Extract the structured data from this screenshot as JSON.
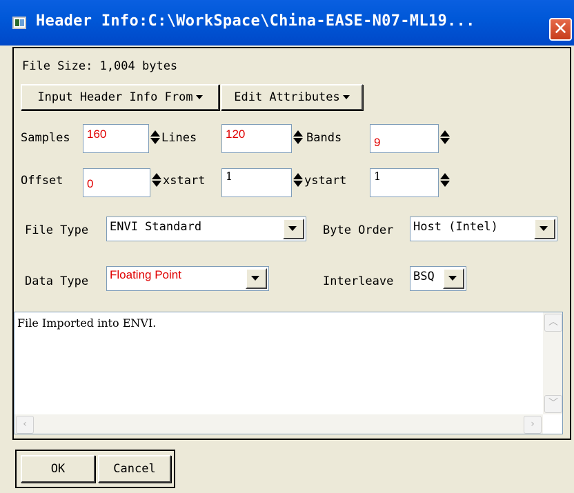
{
  "window": {
    "title": "Header Info:C:\\WorkSpace\\China-EASE-N07-ML19...",
    "close_glyph": "✕"
  },
  "file_size": "File Size: 1,004 bytes",
  "toolbar": {
    "input_header_label": "Input Header Info From",
    "edit_attributes_label": "Edit Attributes"
  },
  "fields": {
    "samples": {
      "label": "Samples",
      "value": "160"
    },
    "lines": {
      "label": "Lines",
      "value": "120"
    },
    "bands": {
      "label": "Bands",
      "value": "9"
    },
    "offset": {
      "label": "Offset",
      "value": "0"
    },
    "xstart": {
      "label": "xstart",
      "value": "1"
    },
    "ystart": {
      "label": "ystart",
      "value": "1"
    }
  },
  "selects": {
    "file_type": {
      "label": "File Type",
      "value": "ENVI Standard"
    },
    "byte_order": {
      "label": "Byte Order",
      "value": "Host (Intel)"
    },
    "data_type": {
      "label": "Data Type",
      "value": "Floating Point"
    },
    "interleave": {
      "label": "Interleave",
      "value": "BSQ"
    }
  },
  "description": "File Imported into ENVI.",
  "buttons": {
    "ok": "OK",
    "cancel": "Cancel"
  },
  "colors": {
    "title_bar": "#0058d8",
    "value_text": "#e00000",
    "close_button": "#d9502e"
  }
}
